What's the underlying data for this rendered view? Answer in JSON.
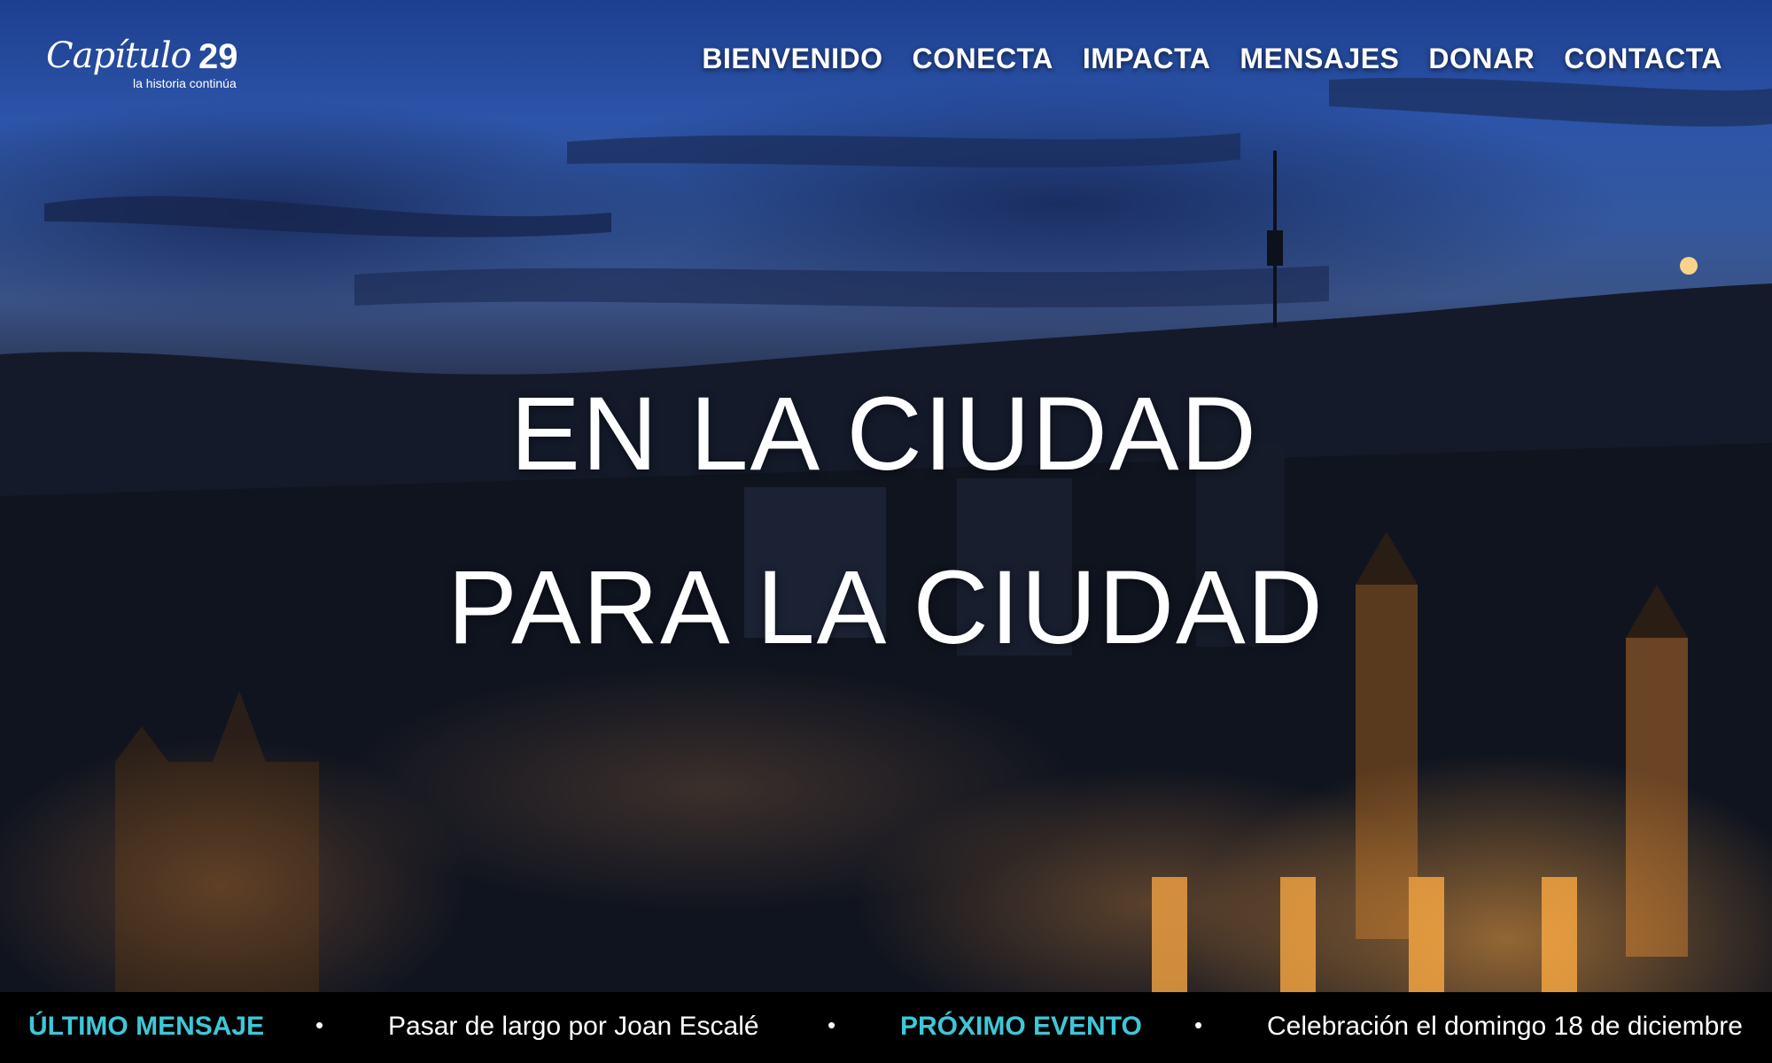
{
  "header": {
    "logo_script": "Capítulo",
    "logo_number": "29",
    "logo_tagline": "la historia continúa",
    "nav": [
      "BIENVENIDO",
      "CONECTA",
      "IMPACTA",
      "MENSAJES",
      "DONAR",
      "CONTACTA"
    ]
  },
  "hero": {
    "line1": "EN LA CIUDAD",
    "line2": "PARA LA CIUDAD"
  },
  "ticker": {
    "latest_label": "ÚLTIMO MENSAJE",
    "separator": "•",
    "latest_text": "Pasar de largo por Joan Escalé",
    "event_label": "PRÓXIMO EVENTO",
    "event_text": "Celebración el domingo 18 de diciembre"
  },
  "colors": {
    "accent": "#3ec7d8",
    "ticker_bg": "#000000"
  }
}
